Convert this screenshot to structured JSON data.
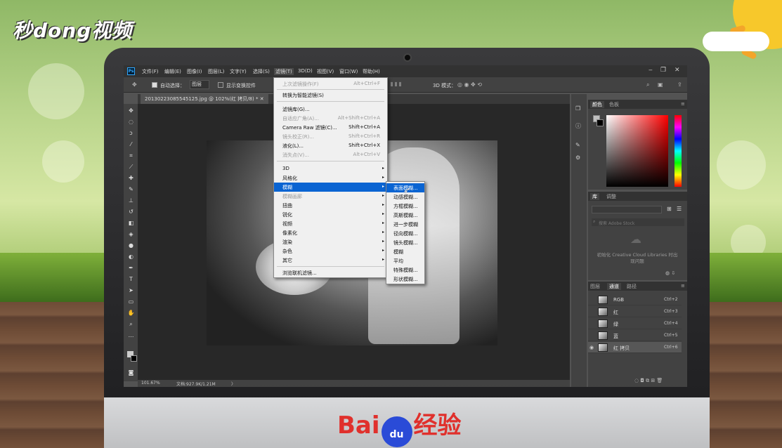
{
  "logo": "秒dong视频",
  "brand": {
    "left": "Bai",
    "paw": "du",
    "right": "经验"
  },
  "menubar": {
    "items": [
      "文件(F)",
      "编辑(E)",
      "图像(I)",
      "图层(L)",
      "文字(Y)",
      "选择(S)",
      "滤镜(T)",
      "3D(D)",
      "视图(V)",
      "窗口(W)",
      "帮助(H)"
    ]
  },
  "options": {
    "auto_select_label": "自动选择：",
    "auto_select_value": "图层",
    "show_transform_label": "显示变换控件",
    "mode_3d": "3D 模式："
  },
  "document": {
    "tab_title": "20130223085545125.jpg @ 102%(红 拷贝/8) *",
    "zoom": "101.67%",
    "doc_size": "文档:927.9K/1.21M"
  },
  "filter_menu": {
    "items": [
      {
        "label": "上次滤镜操作(F)",
        "shortcut": "Alt+Ctrl+F",
        "disabled": true
      },
      {
        "label": "转换为智能滤镜(S)",
        "shortcut": "",
        "disabled": false
      },
      {
        "label": "滤镜库(G)...",
        "shortcut": "",
        "disabled": false
      },
      {
        "label": "自适应广角(A)...",
        "shortcut": "Alt+Shift+Ctrl+A",
        "disabled": true
      },
      {
        "label": "Camera Raw 滤镜(C)...",
        "shortcut": "Shift+Ctrl+A",
        "disabled": false
      },
      {
        "label": "镜头校正(R)...",
        "shortcut": "Shift+Ctrl+R",
        "disabled": true
      },
      {
        "label": "液化(L)...",
        "shortcut": "Shift+Ctrl+X",
        "disabled": false
      },
      {
        "label": "消失点(V)...",
        "shortcut": "Alt+Ctrl+V",
        "disabled": true
      },
      {
        "label": "3D",
        "submenu": true
      },
      {
        "label": "风格化",
        "submenu": true
      },
      {
        "label": "模糊",
        "submenu": true,
        "highlighted": true
      },
      {
        "label": "模糊画廊",
        "submenu": true,
        "disabled": true
      },
      {
        "label": "扭曲",
        "submenu": true
      },
      {
        "label": "锐化",
        "submenu": true
      },
      {
        "label": "视频",
        "submenu": true
      },
      {
        "label": "像素化",
        "submenu": true
      },
      {
        "label": "渲染",
        "submenu": true
      },
      {
        "label": "杂色",
        "submenu": true
      },
      {
        "label": "其它",
        "submenu": true
      },
      {
        "label": "浏览联机滤镜...",
        "shortcut": ""
      }
    ]
  },
  "blur_submenu": {
    "items": [
      "表面模糊...",
      "动感模糊...",
      "方框模糊...",
      "高斯模糊...",
      "进一步模糊",
      "径向模糊...",
      "镜头模糊...",
      "模糊",
      "平均",
      "特殊模糊...",
      "形状模糊..."
    ]
  },
  "color_panel": {
    "tabs": [
      "颜色",
      "色板"
    ]
  },
  "library_panel": {
    "tabs": [
      "库",
      "调整"
    ],
    "search_placeholder": "搜索 Adobe Stock",
    "message": "初始化 Creative Cloud Libraries 时出现问题"
  },
  "channels_panel": {
    "tabs": [
      "图层",
      "通道",
      "路径"
    ],
    "rows": [
      {
        "name": "RGB",
        "shortcut": "Ctrl+2"
      },
      {
        "name": "红",
        "shortcut": "Ctrl+3"
      },
      {
        "name": "绿",
        "shortcut": "Ctrl+4"
      },
      {
        "name": "蓝",
        "shortcut": "Ctrl+5"
      },
      {
        "name": "红 拷贝",
        "shortcut": "Ctrl+6"
      }
    ]
  },
  "colors": {
    "highlight": "#0a64d2",
    "ps_bg": "#535353",
    "panel": "#424242"
  }
}
